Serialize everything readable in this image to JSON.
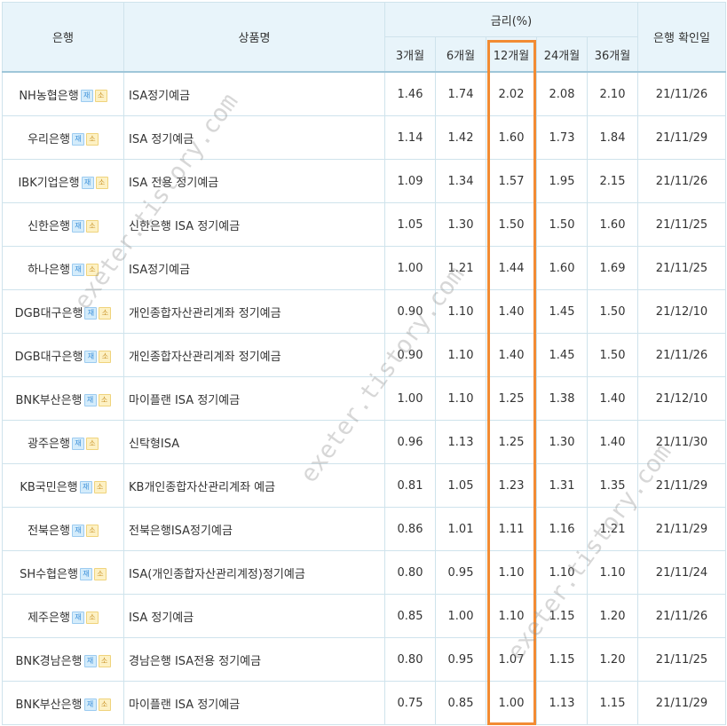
{
  "table": {
    "headers": {
      "bank": "은행",
      "product": "상품명",
      "rate_group": "금리(%)",
      "confirm_date": "은행 확인일",
      "terms": [
        "3개월",
        "6개월",
        "12개월",
        "24개월",
        "36개월"
      ]
    },
    "badges": {
      "new": "재",
      "small": "소"
    },
    "rows": [
      {
        "bank": "NH농협은행",
        "product": "ISA정기예금",
        "r3": "1.46",
        "r6": "1.74",
        "r12": "2.02",
        "r24": "2.08",
        "r36": "2.10",
        "date": "21/11/26"
      },
      {
        "bank": "우리은행",
        "product": "ISA 정기예금",
        "r3": "1.14",
        "r6": "1.42",
        "r12": "1.60",
        "r24": "1.73",
        "r36": "1.84",
        "date": "21/11/29"
      },
      {
        "bank": "IBK기업은행",
        "product": "ISA 전용 정기예금",
        "r3": "1.09",
        "r6": "1.34",
        "r12": "1.57",
        "r24": "1.95",
        "r36": "2.15",
        "date": "21/11/26"
      },
      {
        "bank": "신한은행",
        "product": "신한은행 ISA 정기예금",
        "r3": "1.05",
        "r6": "1.30",
        "r12": "1.50",
        "r24": "1.50",
        "r36": "1.60",
        "date": "21/11/25"
      },
      {
        "bank": "하나은행",
        "product": "ISA정기예금",
        "r3": "1.00",
        "r6": "1.21",
        "r12": "1.44",
        "r24": "1.60",
        "r36": "1.69",
        "date": "21/11/25"
      },
      {
        "bank": "DGB대구은행",
        "product": "개인종합자산관리계좌 정기예금",
        "r3": "0.90",
        "r6": "1.10",
        "r12": "1.40",
        "r24": "1.45",
        "r36": "1.50",
        "date": "21/12/10"
      },
      {
        "bank": "DGB대구은행",
        "product": "개인종합자산관리계좌 정기예금",
        "r3": "0.90",
        "r6": "1.10",
        "r12": "1.40",
        "r24": "1.45",
        "r36": "1.50",
        "date": "21/11/26"
      },
      {
        "bank": "BNK부산은행",
        "product": "마이플랜 ISA 정기예금",
        "r3": "1.00",
        "r6": "1.10",
        "r12": "1.25",
        "r24": "1.38",
        "r36": "1.40",
        "date": "21/12/10"
      },
      {
        "bank": "광주은행",
        "product": "신탁형ISA",
        "r3": "0.96",
        "r6": "1.13",
        "r12": "1.25",
        "r24": "1.30",
        "r36": "1.40",
        "date": "21/11/30"
      },
      {
        "bank": "KB국민은행",
        "product": "KB개인종합자산관리계좌 예금",
        "r3": "0.81",
        "r6": "1.05",
        "r12": "1.23",
        "r24": "1.31",
        "r36": "1.35",
        "date": "21/11/29"
      },
      {
        "bank": "전북은행",
        "product": "전북은행ISA정기예금",
        "r3": "0.86",
        "r6": "1.01",
        "r12": "1.11",
        "r24": "1.16",
        "r36": "1.21",
        "date": "21/11/29"
      },
      {
        "bank": "SH수협은행",
        "product": "ISA(개인종합자산관리계정)정기예금",
        "r3": "0.80",
        "r6": "0.95",
        "r12": "1.10",
        "r24": "1.10",
        "r36": "1.10",
        "date": "21/11/24"
      },
      {
        "bank": "제주은행",
        "product": "ISA 정기예금",
        "r3": "0.85",
        "r6": "1.00",
        "r12": "1.10",
        "r24": "1.15",
        "r36": "1.20",
        "date": "21/11/26"
      },
      {
        "bank": "BNK경남은행",
        "product": "경남은행 ISA전용 정기예금",
        "r3": "0.80",
        "r6": "0.95",
        "r12": "1.07",
        "r24": "1.15",
        "r36": "1.20",
        "date": "21/11/25"
      },
      {
        "bank": "BNK부산은행",
        "product": "마이플랜 ISA 정기예금",
        "r3": "0.75",
        "r6": "0.85",
        "r12": "1.00",
        "r24": "1.13",
        "r36": "1.15",
        "date": "21/11/29"
      }
    ]
  },
  "watermark": {
    "text": "exeter.tistory.com"
  },
  "colors": {
    "header_bg": "#e8f4fa",
    "border": "#cfe3ec",
    "highlight": "#f28b33"
  }
}
